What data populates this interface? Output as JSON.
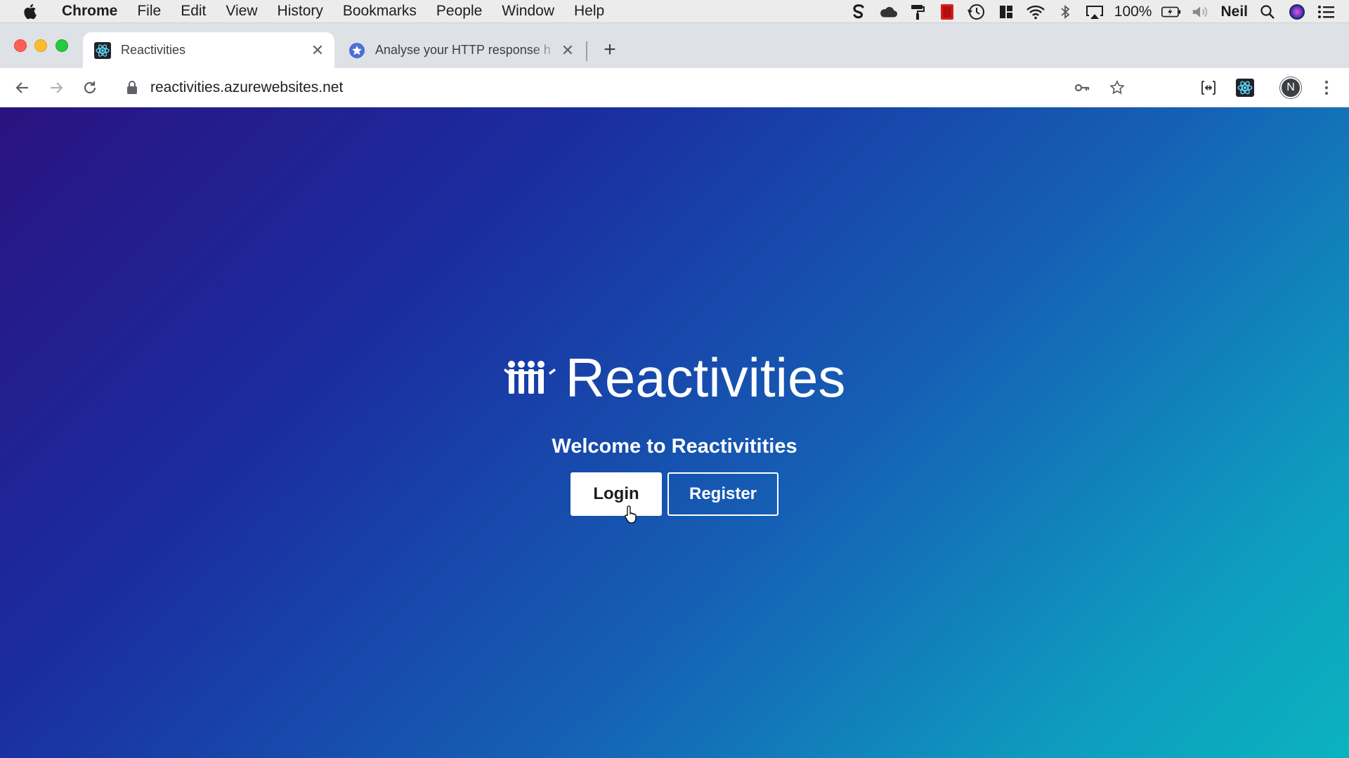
{
  "menubar": {
    "app_name": "Chrome",
    "items": [
      "File",
      "Edit",
      "View",
      "History",
      "Bookmarks",
      "People",
      "Window",
      "Help"
    ],
    "battery": "100%",
    "user": "Neil"
  },
  "tabs": [
    {
      "title": "Reactivities",
      "active": true,
      "favicon": "react-atom-icon"
    },
    {
      "title": "Analyse your HTTP response h",
      "active": false,
      "favicon": "star-badge-icon"
    }
  ],
  "toolbar": {
    "url": "reactivities.azurewebsites.net",
    "profile_initial": "N"
  },
  "page": {
    "brand": "Reactivities",
    "welcome": "Welcome to Reactivitities",
    "login_label": "Login",
    "register_label": "Register"
  },
  "colors": {
    "gradient_start": "#2a1280",
    "gradient_end": "#0bb3bf",
    "menubar_bg": "#ececec",
    "tabstrip_bg": "#dee1e6"
  }
}
